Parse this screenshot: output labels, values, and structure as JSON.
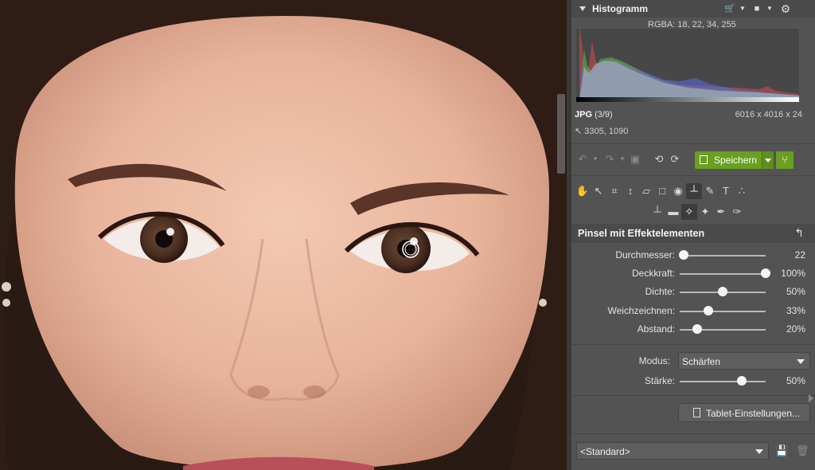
{
  "histogram": {
    "title": "Histogramm",
    "rgba": "RGBA:  18,  22,  34, 255",
    "icons": [
      "cart-icon",
      "dropdown-icon",
      "layers-icon",
      "dropdown-icon",
      "gear-icon"
    ]
  },
  "file": {
    "format": "JPG",
    "index": "(3/9)",
    "dimensions": "6016 x 4016 x 24",
    "cursor": "3305, 1090"
  },
  "toolbar": {
    "save_label": "Speichern"
  },
  "panel": {
    "title": "Pinsel mit Effektelementen",
    "sliders": [
      {
        "label": "Durchmesser:",
        "value": "22",
        "level": 0.05
      },
      {
        "label": "Deckkraft:",
        "value": "100%",
        "level": 1.0
      },
      {
        "label": "Dichte:",
        "value": "50%",
        "level": 0.5
      },
      {
        "label": "Weichzeichnen:",
        "value": "33%",
        "level": 0.33
      },
      {
        "label": "Abstand:",
        "value": "20%",
        "level": 0.2
      }
    ],
    "mode_label": "Modus:",
    "mode_value": "Schärfen",
    "strength": {
      "label": "Stärke:",
      "value": "50%",
      "level": 0.72
    },
    "tablet_label": "Tablet-Einstellungen...",
    "preset_value": "<Standard>"
  },
  "colors": {
    "accent": "#6aa021",
    "panel": "#535353",
    "header": "#4a4a4a"
  }
}
